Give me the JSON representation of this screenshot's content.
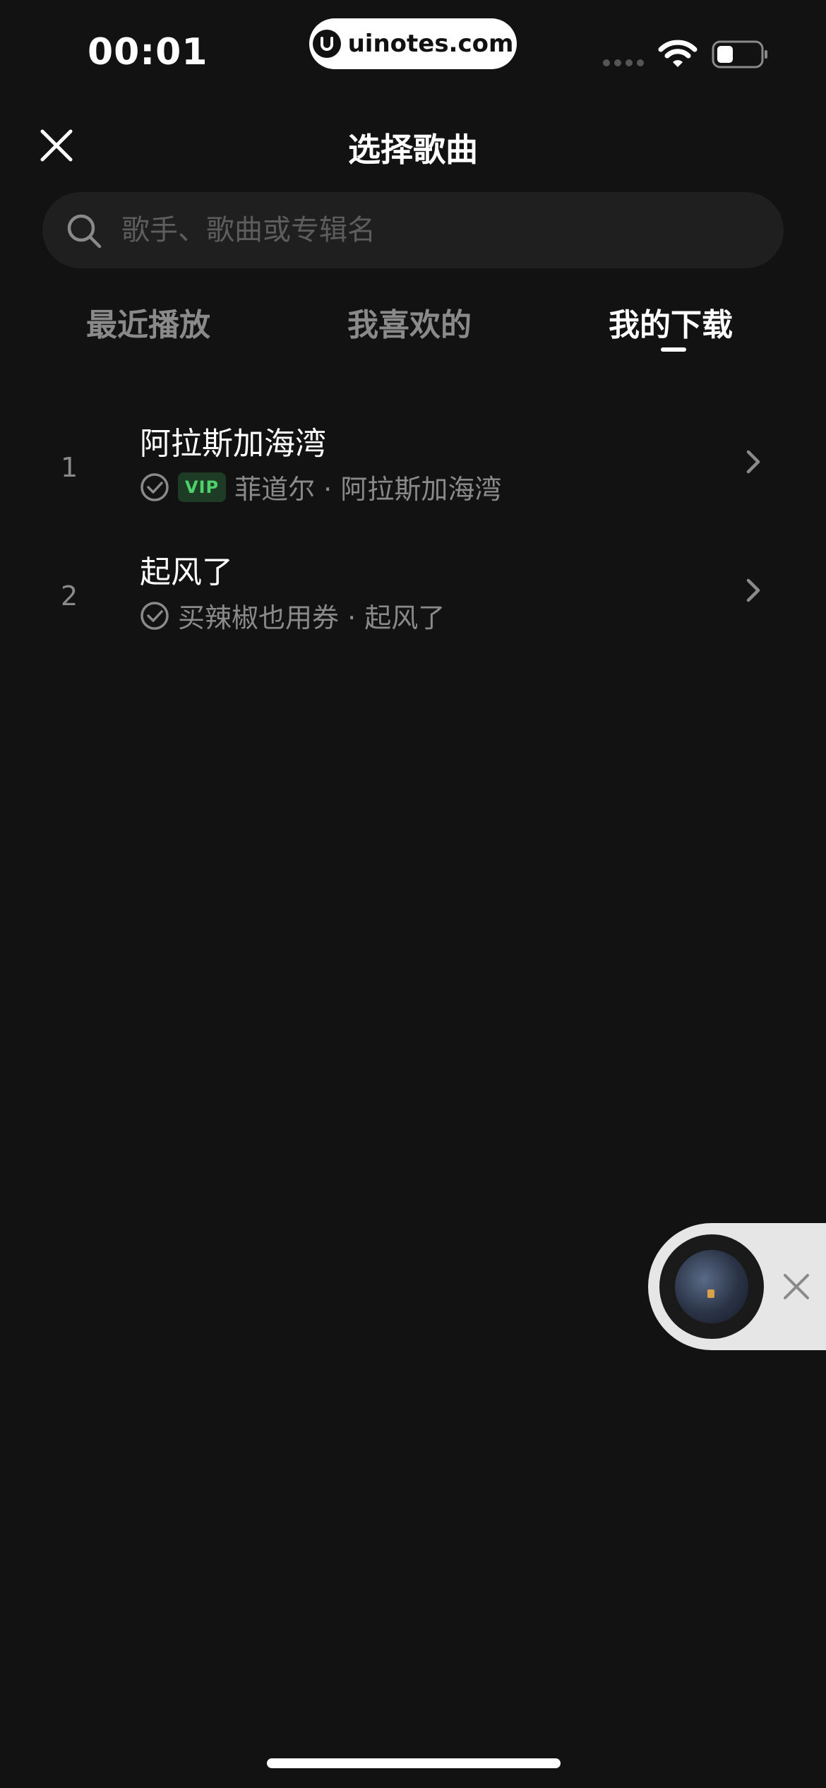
{
  "status_bar": {
    "time": "00:01",
    "watermark": "uinotes.com"
  },
  "header": {
    "title": "选择歌曲"
  },
  "search": {
    "placeholder": "歌手、歌曲或专辑名",
    "value": ""
  },
  "tabs": [
    {
      "label": "最近播放",
      "active": false
    },
    {
      "label": "我喜欢的",
      "active": false
    },
    {
      "label": "我的下载",
      "active": true
    }
  ],
  "songs": [
    {
      "index": "1",
      "title": "阿拉斯加海湾",
      "vip": true,
      "vip_label": "VIP",
      "subtitle": "菲道尔 · 阿拉斯加海湾",
      "downloaded": true
    },
    {
      "index": "2",
      "title": "起风了",
      "vip": false,
      "vip_label": "",
      "subtitle": "买辣椒也用券 · 起风了",
      "downloaded": true
    }
  ],
  "colors": {
    "background": "#121212",
    "search_bg": "#1f1f1f",
    "muted_text": "#8a8a8a",
    "vip_green": "#4ed06a",
    "mini_player_bg": "#e6e6e6"
  },
  "icons": [
    "close-icon",
    "search-icon",
    "check-circle-icon",
    "chevron-right-icon",
    "wifi-icon",
    "battery-icon"
  ]
}
